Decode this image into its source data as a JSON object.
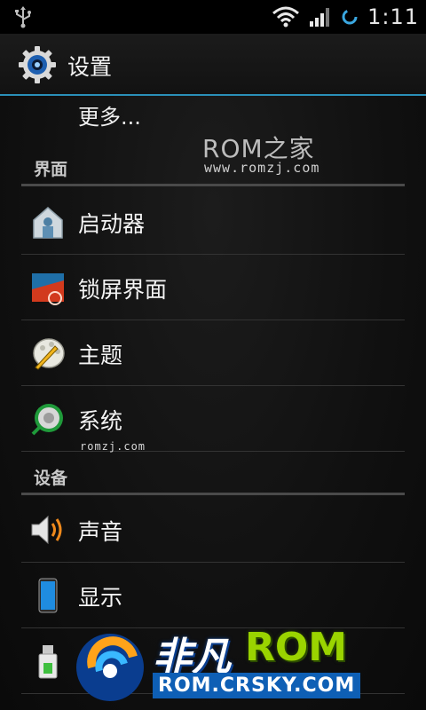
{
  "status_bar": {
    "time": "1:11",
    "icons": [
      "usb-icon",
      "wifi-icon",
      "signal-icon",
      "sync-icon"
    ]
  },
  "action_bar": {
    "icon": "settings-gear-icon",
    "title": "设置"
  },
  "more_item": {
    "label": "更多..."
  },
  "watermark_top": {
    "brand": "ROM之家",
    "url": "www.romzj.com"
  },
  "sections": [
    {
      "header": "界面",
      "items": [
        {
          "label": "启动器",
          "icon": "launcher-icon"
        },
        {
          "label": "锁屏界面",
          "icon": "lockscreen-icon"
        },
        {
          "label": "主题",
          "icon": "theme-icon"
        },
        {
          "label": "系统",
          "icon": "system-icon"
        }
      ]
    },
    {
      "header": "设备",
      "items": [
        {
          "label": "声音",
          "icon": "sound-icon"
        },
        {
          "label": "显示",
          "icon": "display-icon"
        },
        {
          "label": "",
          "icon": "storage-icon"
        }
      ]
    }
  ],
  "watermark_small": "romzj.com",
  "watermark_bottom": {
    "brand_cn": "非凡",
    "brand_rom": "ROM",
    "url": "ROM.CRSKY.COM"
  },
  "colors": {
    "accent": "#2a8fb8",
    "background": "#101010",
    "divider": "#4a4a4a"
  }
}
